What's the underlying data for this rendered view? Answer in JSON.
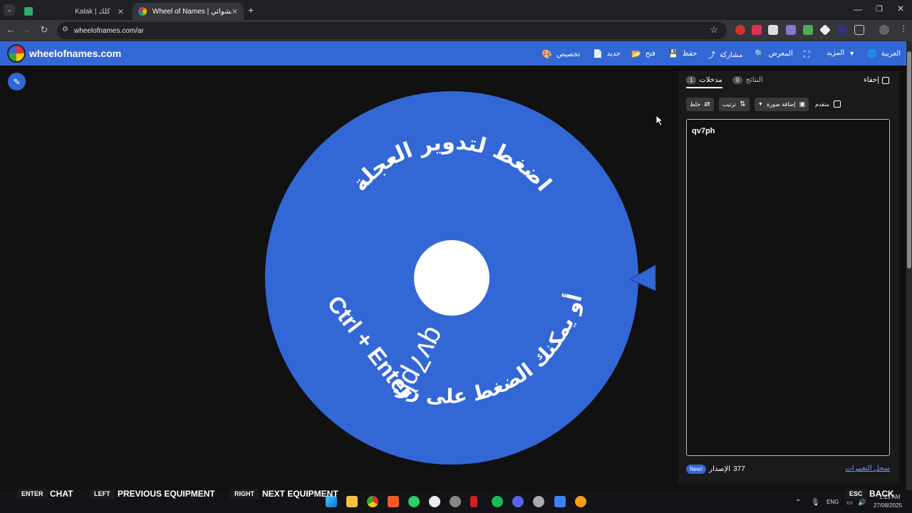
{
  "browser": {
    "tabs": [
      {
        "label": "Kalak | كلك",
        "active": false
      },
      {
        "label": "Wheel of Names | اسم العشوائي",
        "active": true
      }
    ],
    "new_tab": "+",
    "url": "wheelofnames.com/ar"
  },
  "header": {
    "logo": "wheelofnames.com",
    "menu": [
      {
        "label": "العربية",
        "icon": "globe-icon"
      },
      {
        "label": "المزيد",
        "icon": "chevron-down-icon"
      },
      {
        "label": "",
        "icon": "fullscreen-icon"
      },
      {
        "label": "المعرض",
        "icon": "search-icon"
      },
      {
        "label": "مشاركة",
        "icon": "share-icon"
      },
      {
        "label": "حفظ",
        "icon": "save-icon"
      },
      {
        "label": "فتح",
        "icon": "folder-icon"
      },
      {
        "label": "جديد",
        "icon": "file-icon"
      },
      {
        "label": "تخصيص",
        "icon": "palette-icon"
      }
    ]
  },
  "wheel": {
    "color": "#3367d6",
    "line1": "اضغط لتدوير العجلة",
    "line2": "أو يمكنك الضغط على زر",
    "shortcut": "Ctrl + Enter",
    "entry_label": "qv7ph"
  },
  "panel": {
    "hide_label": "إخفاء",
    "tabs": [
      {
        "label": "النتائج",
        "count": "0",
        "active": false
      },
      {
        "label": "مدخلات",
        "count": "1",
        "active": true
      }
    ],
    "shuffle": "خلط",
    "sort": "ترتيب",
    "add_image": "إضافة صورة",
    "advanced": "متقدم",
    "entries": [
      "qv7ph"
    ],
    "version_label": "الإصدار",
    "version_number": "377",
    "new_badge": "New!",
    "changelog": "سجل التغييرات"
  },
  "overlay": {
    "keys": [
      {
        "key": "ENTER",
        "label": "CHAT"
      },
      {
        "key": "LEFT",
        "label": "PREVIOUS EQUIPMENT"
      },
      {
        "key": "RIGHT",
        "label": "NEXT EQUIPMENT"
      },
      {
        "key": "ESC",
        "label": "BACK"
      }
    ]
  },
  "taskbar": {
    "lang": "ENG",
    "time": "1:13 AM",
    "date": "27/08/2025"
  }
}
